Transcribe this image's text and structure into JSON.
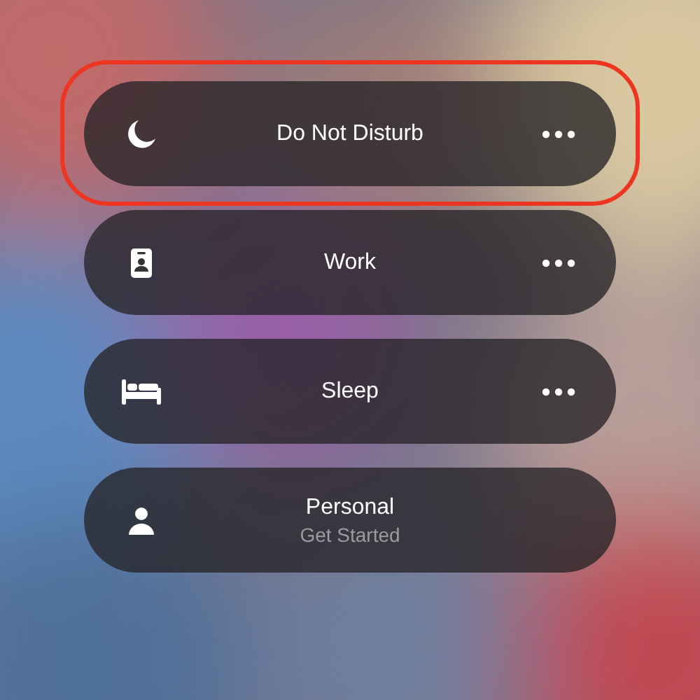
{
  "focus_modes": [
    {
      "kind": "moon",
      "label": "Do Not Disturb",
      "highlighted": true,
      "has_more": true
    },
    {
      "kind": "badge",
      "label": "Work",
      "highlighted": false,
      "has_more": true
    },
    {
      "kind": "bed",
      "label": "Sleep",
      "highlighted": false,
      "has_more": true
    },
    {
      "kind": "person",
      "label": "Personal",
      "subtitle": "Get Started",
      "highlighted": false,
      "has_more": false
    }
  ]
}
